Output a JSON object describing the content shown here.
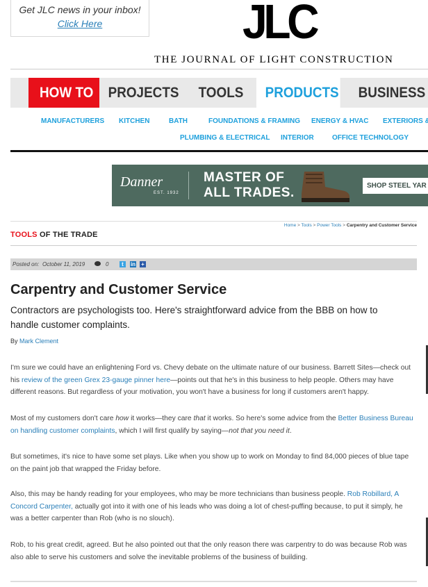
{
  "newsletter": {
    "title": "Get JLC news in your inbox!",
    "link": "Click Here"
  },
  "header": {
    "logo": "JLC",
    "tagline": "THE JOURNAL OF LIGHT CONSTRUCTION"
  },
  "main_nav": [
    "HOW TO",
    "PROJECTS",
    "TOOLS",
    "PRODUCTS",
    "BUSINESS"
  ],
  "sub_nav": {
    "row1": [
      "MANUFACTURERS",
      "KITCHEN",
      "BATH",
      "FOUNDATIONS & FRAMING",
      "ENERGY & HVAC",
      "EXTERIORS & R"
    ],
    "row2": [
      "PLUMBING & ELECTRICAL",
      "INTERIOR",
      "OFFICE TECHNOLOGY"
    ]
  },
  "ad": {
    "brand": "Danner",
    "est": "EST. 1932",
    "headline1": "MASTER OF",
    "headline2": "ALL TRADES.",
    "cta": "SHOP STEEL YAR"
  },
  "section": {
    "title_red": "TOOLS",
    "title_rest": "OF THE TRADE"
  },
  "breadcrumb": {
    "home": "Home",
    "tools": "Tools",
    "power_tools": "Power Tools",
    "current": "Carpentry and Customer Service"
  },
  "meta": {
    "posted_label": "Posted on:",
    "date": "October 11, 2019",
    "comment_count": "0"
  },
  "article": {
    "title": "Carpentry and Customer Service",
    "deck": "Contractors are psychologists too. Here's straightforward advice from the BBB on how to handle customer complaints.",
    "by_label": "By",
    "author": "Mark Clement",
    "p1_a": "I'm sure we could have an enlightening Ford vs. Chevy debate on the ultimate nature of our business. Barrett Sites—check out his ",
    "p1_link": "review of the green Grex 23-gauge pinner here",
    "p1_b": "—points out that he's in this business to help people. Others may have different reasons. But regardless of your motivation, you won't have a business for long if customers aren't happy.",
    "p2_a": "Most of my customers don't care ",
    "p2_em1": "how",
    "p2_b": " it works—they care ",
    "p2_em2": "that",
    "p2_c": " it works. So here's some advice from the ",
    "p2_link": "Better Business Bureau on handling customer complaints",
    "p2_d": ", which I will first qualify by saying—",
    "p2_em3": "not that you need it",
    "p2_e": ".",
    "p3": "But sometimes, it's nice to have some set plays. Like when you show up to work on Monday to find 84,000 pieces of blue tape on the paint job that wrapped the Friday before.",
    "p4_a": "Also, this may be handy reading for your employees, who may be more technicians than business people. ",
    "p4_link": "Rob Robillard, A Concord Carpenter,",
    "p4_b": " actually got into it with one of his leads who was doing a lot of chest-puffing because, to put it simply, he was a better carpenter than Rob (who is no slouch).",
    "p5": "Rob, to his great credit, agreed. But he also pointed out that the only reason there was carpentry to do was because Rob was also able to serve his customers and solve the inevitable problems of the business of building."
  },
  "colors": {
    "red": "#e8101a",
    "blue": "#1ea0dc",
    "link": "#2a7fb8",
    "ad_green": "#4e6a5f"
  }
}
